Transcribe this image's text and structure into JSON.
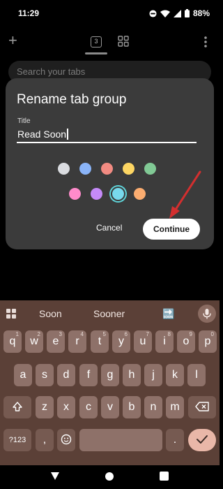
{
  "status_bar": {
    "time": "11:29",
    "battery_pct": "88%"
  },
  "toolbar": {
    "tab_count": "3"
  },
  "search": {
    "placeholder": "Search your tabs"
  },
  "dialog": {
    "title": "Rename tab group",
    "field_label": "Title",
    "field_value": "Read Soon",
    "colors": [
      "#dadce0",
      "#8ab4f8",
      "#f28b82",
      "#fdd663",
      "#81c995",
      "#ff8bcb",
      "#c58af9",
      "#78d9ec",
      "#fcad70"
    ],
    "selected_color_index": 7,
    "cancel_label": "Cancel",
    "continue_label": "Continue"
  },
  "keyboard": {
    "suggestions": [
      "Soon",
      "Sooner"
    ],
    "emoji_suggestion": "🔜",
    "row1": [
      "q",
      "w",
      "e",
      "r",
      "t",
      "y",
      "u",
      "i",
      "o",
      "p"
    ],
    "row1_sup": [
      "1",
      "2",
      "3",
      "4",
      "5",
      "6",
      "7",
      "8",
      "9",
      "0"
    ],
    "row2": [
      "a",
      "s",
      "d",
      "f",
      "g",
      "h",
      "j",
      "k",
      "l"
    ],
    "row3": [
      "z",
      "x",
      "c",
      "v",
      "b",
      "n",
      "m"
    ],
    "symbols_label": "?123",
    "comma": ",",
    "period": "."
  },
  "colors": {
    "dialog_bg": "#3b3b3b",
    "keyboard_bg": "#5b4037",
    "key_bg": "#8e7169",
    "enter_key": "#e9b7a8",
    "annotation_arrow": "#d32f2f"
  }
}
